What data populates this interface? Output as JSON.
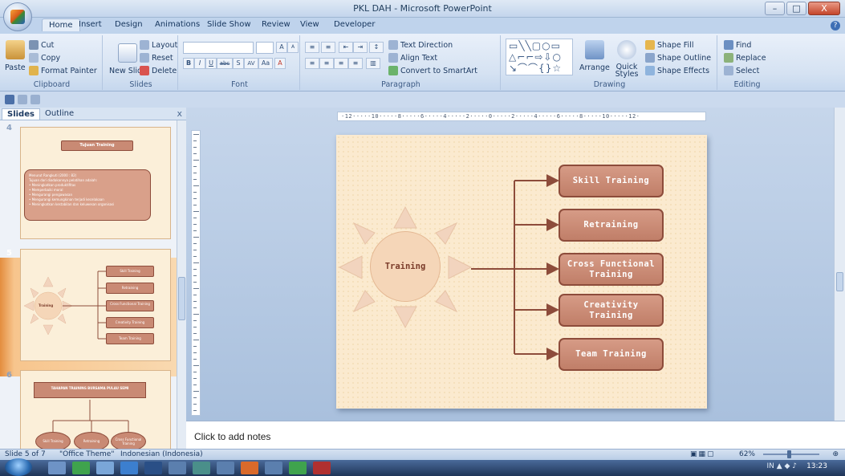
{
  "window": {
    "title": "PKL DAH - Microsoft PowerPoint",
    "controls": {
      "minimize": "–",
      "maximize": "□",
      "close": "X"
    }
  },
  "ribbon_tabs": [
    "Home",
    "Insert",
    "Design",
    "Animations",
    "Slide Show",
    "Review",
    "View",
    "Developer"
  ],
  "ribbon": {
    "clipboard": {
      "paste": "Paste",
      "cut": "Cut",
      "copy": "Copy",
      "format_painter": "Format Painter",
      "label": "Clipboard"
    },
    "slides": {
      "new_slide": "New Slide",
      "layout": "Layout",
      "reset": "Reset",
      "delete": "Delete",
      "label": "Slides"
    },
    "font": {
      "label": "Font",
      "bold": "B",
      "italic": "I",
      "underline": "U",
      "strike": "abc",
      "shadow": "S",
      "spacing": "AV",
      "case": "Aa",
      "color": "A",
      "grow": "A",
      "shrink": "A"
    },
    "paragraph": {
      "text_direction": "Text Direction",
      "align_text": "Align Text",
      "convert_smartart": "Convert to SmartArt",
      "label": "Paragraph"
    },
    "drawing": {
      "arrange": "Arrange",
      "quick_styles": "Quick Styles",
      "shape_fill": "Shape Fill",
      "shape_outline": "Shape Outline",
      "shape_effects": "Shape Effects",
      "label": "Drawing"
    },
    "editing": {
      "find": "Find",
      "replace": "Replace",
      "select": "Select",
      "label": "Editing"
    }
  },
  "panel": {
    "tab_slides": "Slides",
    "tab_outline": "Outline",
    "close": "x"
  },
  "thumbnails": [
    {
      "number": "4",
      "title": "Tujuan Training",
      "box_lines": [
        "Menurut Rangkuti (2000 : 82)",
        "Tujuan dari diadakannya pelatihan adalah:",
        "• Meningkatkan produktifitas",
        "• Memperbaiki moral",
        "• Mengurangi pengawasan",
        "• Mengurangi kemungkinan terjadi kecelakaan",
        "• Meningkatkan kestabilan dan keluwesan organisasi"
      ]
    },
    {
      "number": "5",
      "center": "Training",
      "items": [
        "Skill Training",
        "Retraining",
        "Cross Functional Training",
        "Creativity Training",
        "Team Training"
      ]
    },
    {
      "number": "6",
      "title": "TAHAPAN TRAINING BURSAMA PULAU SEMI",
      "ovals": [
        "Skill Training",
        "Retraining",
        "Cross Functional Training"
      ]
    }
  ],
  "ruler_text": "·12·····10·····8·····6·····4·····2·····0·····2·····4·····6·····8·····10·····12·",
  "slide": {
    "center_label": "Training",
    "boxes": [
      "Skill Training",
      "Retraining",
      "Cross Functional Training",
      "Creativity Training",
      "Team Training"
    ],
    "colors": {
      "box_fill": "#c98a74",
      "box_border": "#8d4c3b",
      "arrow": "#8d4c3b",
      "sun": "#f5d6b8",
      "background": "#fbeacf"
    }
  },
  "notes_placeholder": "Click to add notes",
  "status": {
    "slide_info": "Slide 5 of 7",
    "theme": "\"Office Theme\"",
    "language": "Indonesian (Indonesia)",
    "zoom": "62%"
  },
  "taskbar": {
    "clock": "13:23",
    "lang": "IN"
  }
}
